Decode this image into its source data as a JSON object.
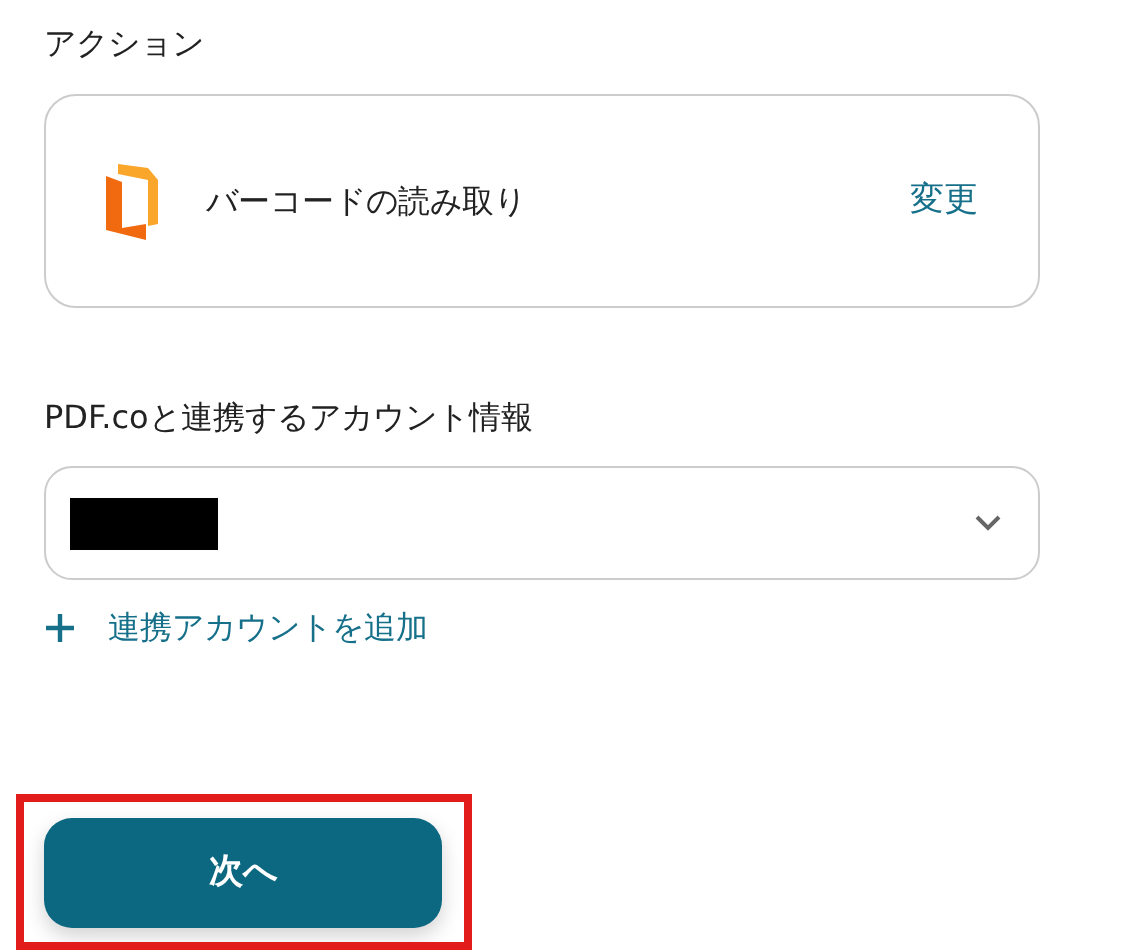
{
  "action": {
    "heading": "アクション",
    "name": "バーコードの読み取り",
    "change_link": "変更"
  },
  "account": {
    "heading": "PDF.coと連携するアカウント情報",
    "value_redacted": true,
    "add_link": "連携アカウントを追加"
  },
  "next_button": {
    "label": "次へ",
    "highlighted": true
  }
}
